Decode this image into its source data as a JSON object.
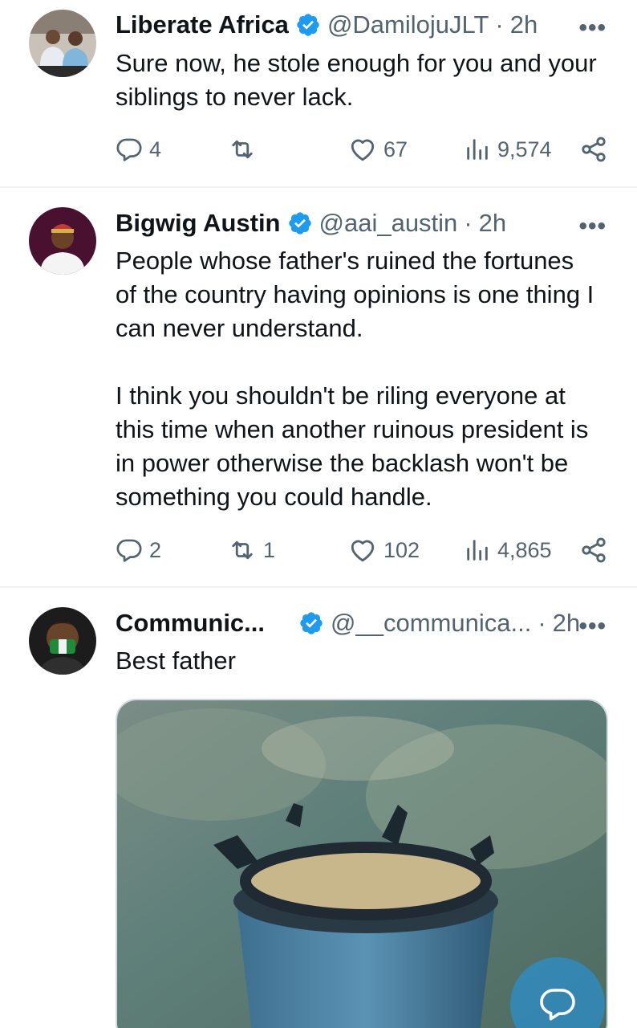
{
  "tweets": [
    {
      "name": "Liberate Africa",
      "handle": "@DamilojuJLT",
      "time": "2h",
      "text": "Sure now, he stole enough for you and your\nsiblings to never lack.",
      "replies": "4",
      "retweets": "",
      "likes": "67",
      "views": "9,574"
    },
    {
      "name": "Bigwig Austin",
      "handle": "@aai_austin",
      "time": "2h",
      "text": "People whose father's ruined the fortunes\nof the country having opinions is one thing I\ncan never understand.\n\nI think you shouldn't be riling everyone at\nthis time when another ruinous president is\nin power otherwise the backlash won't be\nsomething you could handle.",
      "replies": "2",
      "retweets": "1",
      "likes": "102",
      "views": "4,865"
    },
    {
      "name": "Communic...",
      "handle": "@__communica...",
      "time": "2h",
      "text": "Best father"
    }
  ],
  "separator": "·",
  "more_glyph": "•••",
  "colors": {
    "accent": "#1d9bf0",
    "muted": "#536471",
    "divider": "#eff3f4"
  },
  "icons": [
    "verified-badge-icon",
    "reply-icon",
    "retweet-icon",
    "like-icon",
    "views-icon",
    "share-icon",
    "more-icon",
    "compose-reply-icon"
  ]
}
